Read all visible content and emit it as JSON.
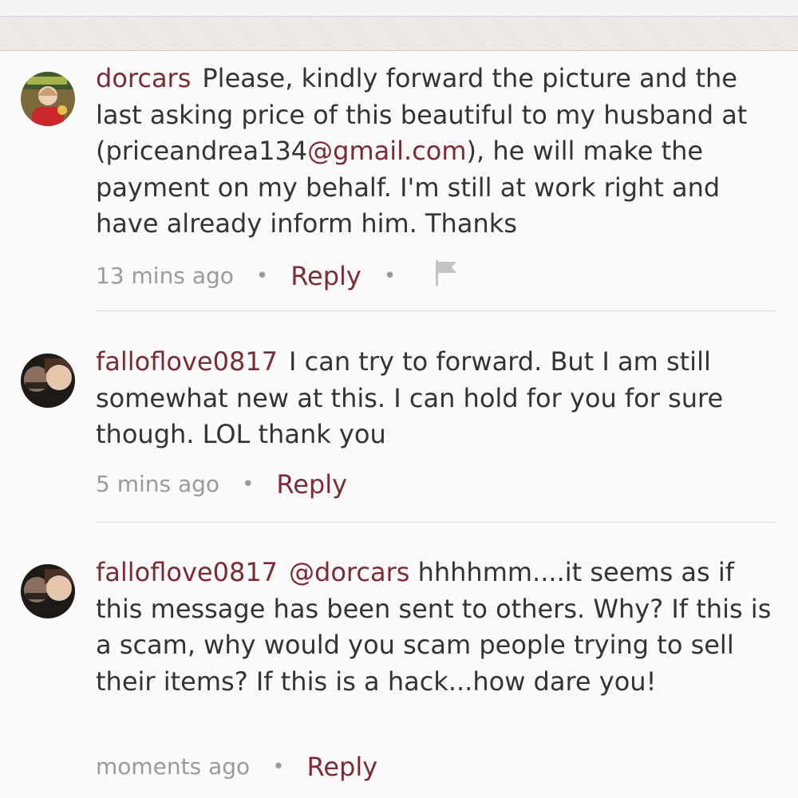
{
  "comments": [
    {
      "username": "dorcars",
      "text_before": "Please, kindly forward the picture and the last asking price of this beautiful to my husband at (priceandrea134",
      "email_link": "@gmail.com",
      "text_after": "), he will make the payment on my behalf. I'm still at work right and have already inform him. Thanks",
      "time": "13 mins ago",
      "reply_label": "Reply"
    },
    {
      "username": "falloflove0817",
      "text": "I can try to forward. But I am still somewhat new at this. I can hold for you for sure though. LOL thank you",
      "time": "5 mins ago",
      "reply_label": "Reply"
    },
    {
      "username": "falloflove0817",
      "mention": "@dorcars",
      "text": "hhhhmm....it seems as if this message has been sent to others. Why? If this is a scam, why would you scam people trying to sell their items? If this is a hack...how dare you!",
      "time": "moments ago",
      "reply_label": "Reply"
    }
  ],
  "colors": {
    "link": "#7a2b36",
    "text": "#333333",
    "muted": "#9a9a9a"
  },
  "icons": {
    "separator": "•",
    "report": "flag-icon"
  }
}
